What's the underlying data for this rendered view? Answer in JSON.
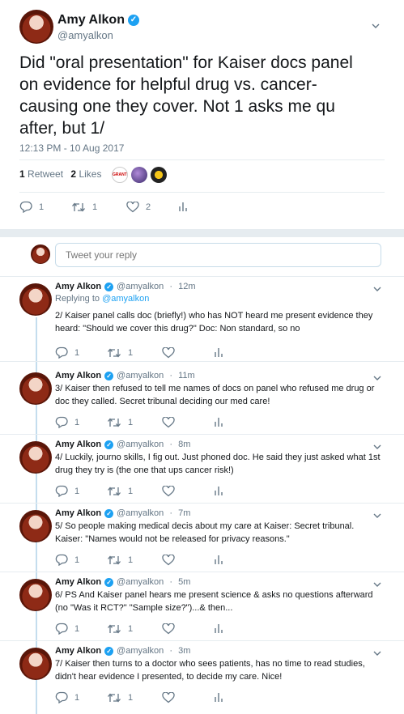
{
  "main_tweet": {
    "author_name": "Amy Alkon",
    "handle": "@amyalkon",
    "text": "Did \"oral presentation\" for Kaiser docs panel on evidence for helpful drug vs. cancer-causing one they cover. Not 1 asks me qu after, but 1/",
    "timestamp": "12:13 PM - 10 Aug 2017",
    "retweets_count": "1",
    "retweets_label": "Retweet",
    "likes_count": "2",
    "likes_label": "Likes",
    "reply_count": "1",
    "retweet_count_action": "1",
    "like_count_action": "2",
    "liker_1_text": "GRANTED"
  },
  "reply_box": {
    "placeholder": "Tweet your reply"
  },
  "replies": [
    {
      "name": "Amy Alkon",
      "handle": "@amyalkon",
      "time": "12m",
      "replying_prefix": "Replying to",
      "replying_to": "@amyalkon",
      "text": "2/ Kaiser panel calls doc (briefly!) who has NOT heard me present evidence they heard: \"Should we cover this drug?\" Doc: Non standard, so no",
      "reply_count": "1",
      "retweet_count": "1"
    },
    {
      "name": "Amy Alkon",
      "handle": "@amyalkon",
      "time": "11m",
      "text": "3/ Kaiser then refused to tell me names of docs on panel who refused me drug or doc they called. Secret tribunal deciding our med care!",
      "reply_count": "1",
      "retweet_count": "1"
    },
    {
      "name": "Amy Alkon",
      "handle": "@amyalkon",
      "time": "8m",
      "text": "4/ Luckily, journo skills, I fig out. Just phoned doc. He said they just asked what 1st drug they try is (the one that ups cancer risk!)",
      "reply_count": "1",
      "retweet_count": "1"
    },
    {
      "name": "Amy Alkon",
      "handle": "@amyalkon",
      "time": "7m",
      "text": "5/ So people making medical decis about my care at Kaiser: Secret tribunal. Kaiser: \"Names would not be released for privacy reasons.\"",
      "reply_count": "1",
      "retweet_count": "1"
    },
    {
      "name": "Amy Alkon",
      "handle": "@amyalkon",
      "time": "5m",
      "text": "6/ PS And Kaiser panel hears me present science & asks no questions afterward (no \"Was it RCT?\" \"Sample size?\")...& then...",
      "reply_count": "1",
      "retweet_count": "1"
    },
    {
      "name": "Amy Alkon",
      "handle": "@amyalkon",
      "time": "3m",
      "text": "7/ Kaiser then turns to a doctor who sees patients, has no time to read studies, didn't hear evidence I presented, to decide my care. Nice!",
      "reply_count": "1",
      "retweet_count": "1"
    }
  ],
  "sep": " · ",
  "verified_mark": "✓",
  "icons": {
    "reply": "reply-icon",
    "retweet": "retweet-icon",
    "like": "heart-icon",
    "analytics": "analytics-icon",
    "more": "chevron-down-icon",
    "verified": "verified-badge-icon"
  },
  "colors": {
    "accent": "#1da1f2",
    "text": "#14171a",
    "secondary": "#657786",
    "divider": "#e6ecf0"
  }
}
